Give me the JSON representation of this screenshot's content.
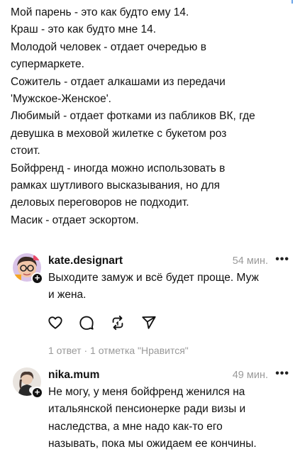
{
  "post": {
    "lines": [
      "Мой парень - это как будто ему 14.",
      "Краш - это как будто мне 14.",
      "Молодой человек - отдает очередью в",
      "супермаркете.",
      "Сожитель - отдает алкашами из передачи",
      "'Мужское-Женское'.",
      "Любимый - отдает фотками из пабликов ВК, где",
      "девушка в меховой жилетке с букетом роз",
      "стоит.",
      "Бойфренд - иногда можно использовать в",
      "рамках шутливого высказывания, но для",
      "деловых переговоров не подходит.",
      "Масик - отдает эскортом."
    ]
  },
  "comments": [
    {
      "username": "kate.designart",
      "time": "54 мин.",
      "more": "•••",
      "lines": [
        "Выходите замуж и всё будет проще. Муж",
        "и жена."
      ],
      "actions": [
        "heart-icon",
        "comment-icon",
        "repost-icon",
        "share-icon"
      ],
      "stats": "1 ответ · 1 отметка \"Нравится\""
    },
    {
      "username": "nika.mum",
      "time": "49 мин.",
      "more": "•••",
      "lines": [
        "Не могу, у меня бойфренд женился на",
        "итальянской пенсионерке ради визы и",
        "наследства, а мне надо как-то его",
        "называть, пока мы ожидаем ее кончины."
      ]
    }
  ],
  "badge": "+"
}
